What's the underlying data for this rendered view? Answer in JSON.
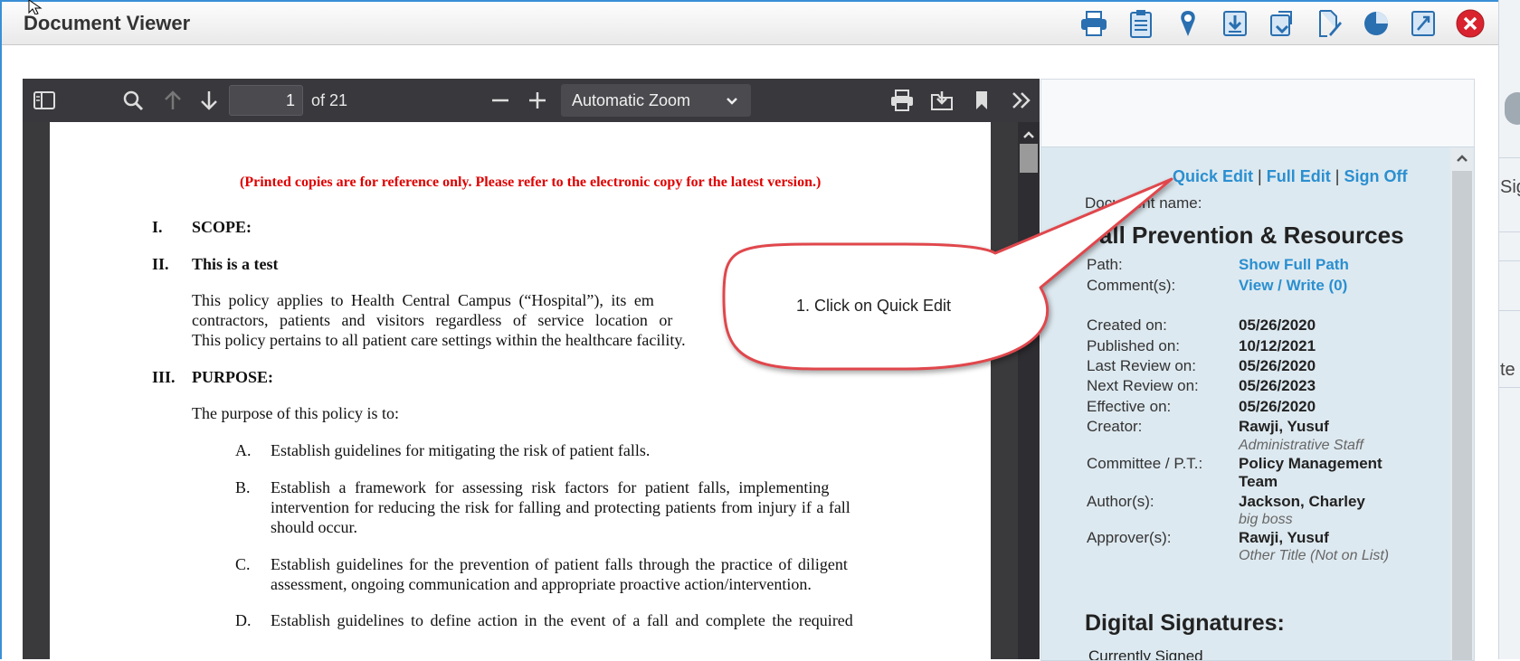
{
  "window": {
    "title": "Document Viewer"
  },
  "title_toolbar": {
    "icons": [
      "printer-icon",
      "clipboard-icon",
      "location-pin-icon",
      "download-icon",
      "export-icon",
      "sign-pen-icon",
      "pie-chart-icon",
      "compare-icon",
      "close-icon"
    ]
  },
  "pdf_toolbar": {
    "page_number": "1",
    "of_pages": "of 21",
    "zoom": "Automatic Zoom"
  },
  "pdf_page": {
    "notice": "(Printed copies are for reference only. Please refer to the electronic copy for the latest version.)",
    "section1_num": "I.",
    "section1_title": "SCOPE:",
    "section2_num": "II.",
    "section2_title": "This is a test",
    "scope_line1": "This policy applies to Health Central Campus (“Hospital”), its em",
    "scope_line2": "contractors, patients and visitors regardless of service location or",
    "scope_line3": "This policy pertains to all patient care settings within the healthcare facility.",
    "section3_num": "III.",
    "section3_title": "PURPOSE:",
    "purpose_intro": "The purpose of this policy is to:",
    "itemA_label": "A.",
    "itemA_line1": "Establish guidelines for mitigating the risk of patient falls.",
    "itemB_label": "B.",
    "itemB_line1": "Establish a framework for assessing risk factors for patient falls, implementing",
    "itemB_line2": "intervention for reducing the risk for falling and protecting patients from injury if a fall",
    "itemB_line3": "should occur.",
    "itemC_label": "C.",
    "itemC_line1": "Establish guidelines for the prevention of patient falls through the practice of diligent",
    "itemC_line2": "assessment, ongoing communication and appropriate proactive action/intervention.",
    "itemD_label": "D.",
    "itemD_line1": "Establish guidelines to define action in the event of a fall and complete the required"
  },
  "info_panel": {
    "quick_edit": "Quick Edit",
    "full_edit": "Full Edit",
    "sign_off": "Sign Off",
    "separator": "|",
    "doc_name_label": "Document name:",
    "doc_name": "Fall Prevention & Resources",
    "path_label": "Path:",
    "path_value": "Show Full Path",
    "comments_label": "Comment(s):",
    "comments_value": "View / Write (0)",
    "created_label": "Created on:",
    "created_value": "05/26/2020",
    "published_label": "Published on:",
    "published_value": "10/12/2021",
    "last_review_label": "Last Review on:",
    "last_review_value": "05/26/2020",
    "next_review_label": "Next Review on:",
    "next_review_value": "05/26/2023",
    "effective_label": "Effective on:",
    "effective_value": "05/26/2020",
    "creator_label": "Creator:",
    "creator_value": "Rawji, Yusuf",
    "creator_title": "Administrative Staff",
    "committee_label": "Committee / P.T.:",
    "committee_value1": "Policy Management",
    "committee_value2": "Team",
    "authors_label": "Author(s):",
    "authors_value": "Jackson, Charley",
    "authors_title": "big boss",
    "approvers_label": "Approver(s):",
    "approvers_value": "Rawji, Yusuf",
    "approvers_title": "Other Title (Not on List)",
    "digital_signatures": "Digital Signatures:",
    "currently_signed": "Currently Signed"
  },
  "callout": {
    "text": "1. Click on Quick Edit"
  },
  "edge_strip": {
    "text1": "Sig",
    "text2": "te"
  },
  "colors": {
    "accent_blue": "#2a8fd0",
    "notice_red": "#e00000",
    "close_red": "#d9232e",
    "callout_border": "#e0474c"
  }
}
